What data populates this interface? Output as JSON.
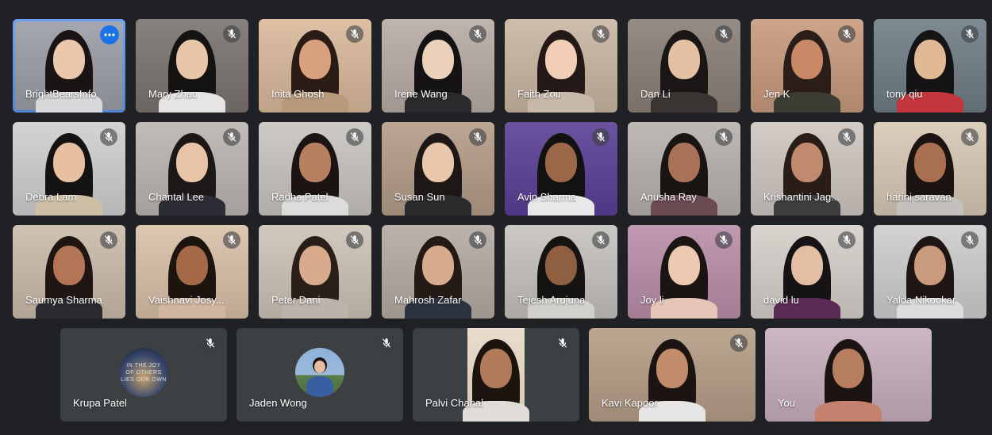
{
  "participants": [
    {
      "name": "BrightBearsInfo",
      "bg": "#9a9ea6",
      "hair": "#1a1414",
      "shirt": "#d8d8da",
      "skin": "#e9c8ae",
      "active": true,
      "muted": false
    },
    {
      "name": "Mary Zhao",
      "bg": "#7a7470",
      "hair": "#151212",
      "shirt": "#e6e4e4",
      "skin": "#e8c6a8",
      "muted": true
    },
    {
      "name": "Inita Ghosh",
      "bg": "#d9b99a",
      "hair": "#2a1c14",
      "shirt": "#b79a7c",
      "skin": "#d9a07e",
      "muted": true
    },
    {
      "name": "Irene Wang",
      "bg": "#b8aba5",
      "hair": "#151213",
      "shirt": "#2a2a2c",
      "skin": "#ead0b8",
      "muted": true
    },
    {
      "name": "Faith Zou",
      "bg": "#c9b6a2",
      "hair": "#241916",
      "shirt": "#c7b9a9",
      "skin": "#f0cfb6",
      "muted": true
    },
    {
      "name": "Dan Li",
      "bg": "#8b7f76",
      "hair": "#1a1616",
      "shirt": "#3a3533",
      "skin": "#e5c1a3",
      "muted": true
    },
    {
      "name": "Jen K",
      "bg": "#c79a7d",
      "hair": "#2b1e18",
      "shirt": "#3c3c34",
      "skin": "#c98966",
      "muted": true
    },
    {
      "name": "tony qiu",
      "bg": "#6f7d86",
      "hair": "#151315",
      "shirt": "#c3363e",
      "skin": "#e0b996",
      "muted": true
    },
    {
      "name": "Debra Lam",
      "bg": "#cfcfcf",
      "hair": "#151212",
      "shirt": "#cec0a5",
      "skin": "#e6c0a0",
      "muted": true
    },
    {
      "name": "Chantal Lee",
      "bg": "#bbb5b0",
      "hair": "#1d1818",
      "shirt": "#2c2d36",
      "skin": "#e7c4a8",
      "muted": true
    },
    {
      "name": "Radha Patel",
      "bg": "#c8c4c0",
      "hair": "#1b1412",
      "shirt": "#dcdcda",
      "skin": "#b78060",
      "muted": true
    },
    {
      "name": "Susan Sun",
      "bg": "#b49b87",
      "hair": "#1d1716",
      "shirt": "#2b2b2d",
      "skin": "#e9c7ad",
      "muted": true
    },
    {
      "name": "Avin Sharma",
      "bg": "#5a3f95",
      "hair": "#121212",
      "shirt": "#e8e8e8",
      "skin": "#9a6848",
      "muted": true
    },
    {
      "name": "Anusha Ray",
      "bg": "#b7b1ad",
      "hair": "#1a1413",
      "shirt": "#6b4a52",
      "skin": "#a87258",
      "muted": true
    },
    {
      "name": "Krishantini Jag...",
      "bg": "#cec6c0",
      "hair": "#2a1d17",
      "shirt": "#3e3d40",
      "skin": "#c08a6e",
      "muted": true
    },
    {
      "name": "harini saravan",
      "bg": "#d8c8b4",
      "hair": "#1b1412",
      "shirt": "#c3c0bd",
      "skin": "#a87050",
      "muted": true
    },
    {
      "name": "Saumya Sharma",
      "bg": "#cabba9",
      "hair": "#1f1512",
      "shirt": "#2a2b30",
      "skin": "#b27555",
      "muted": true
    },
    {
      "name": "Vaishnavi Josy...",
      "bg": "#d8c0a8",
      "hair": "#1d1410",
      "shirt": "#d2b6a0",
      "skin": "#a46a48",
      "muted": true
    },
    {
      "name": "Peter Dani",
      "bg": "#cdc2b6",
      "hair": "#2a1e18",
      "shirt": "#bdb3aa",
      "skin": "#d7ab8c",
      "muted": true
    },
    {
      "name": "Mahrosh Zafar",
      "bg": "#b3aaa2",
      "hair": "#241915",
      "shirt": "#2c3340",
      "skin": "#d6ab8e",
      "muted": true
    },
    {
      "name": "Tejesh Arujuna",
      "bg": "#c5c2bd",
      "hair": "#151212",
      "shirt": "#d2d0cc",
      "skin": "#8f5f42",
      "muted": true
    },
    {
      "name": "Joy li",
      "bg": "#b88ea8",
      "hair": "#1a1413",
      "shirt": "#e6c6b8",
      "skin": "#ecc9b0",
      "muted": true
    },
    {
      "name": "david lu",
      "bg": "#d5cfc9",
      "hair": "#151313",
      "shirt": "#5b2a55",
      "skin": "#e2bea2",
      "muted": true
    },
    {
      "name": "Yalda Nikookar",
      "bg": "#cdcdcd",
      "hair": "#1f1614",
      "shirt": "#dcdcdc",
      "skin": "#c99a7e",
      "muted": true
    },
    {
      "name": "Krupa Patel",
      "bg": "#3c4043",
      "avatar": "book",
      "muted": true
    },
    {
      "name": "Jaden Wong",
      "bg": "#3c4043",
      "avatar": "photo",
      "muted": true
    },
    {
      "name": "Palvi Chahal",
      "bg": "#3c4043",
      "hair": "#1d1410",
      "shirt": "#e0dcd8",
      "skin": "#b17a5a",
      "portrait": true,
      "muted": true
    },
    {
      "name": "Kavi Kapoor",
      "bg": "#b49d86",
      "hair": "#1c1412",
      "shirt": "#e8e6e4",
      "skin": "#c08c6a",
      "muted": true
    },
    {
      "name": "You",
      "bg": "#c8aebc",
      "hair": "#1c1412",
      "shirt": "#c5816e",
      "skin": "#b87e60",
      "muted": false
    }
  ],
  "avatar_book": {
    "line1": "IN THE JOY",
    "line2": "OF OTHERS",
    "line3": "LIES OUR OWN"
  }
}
